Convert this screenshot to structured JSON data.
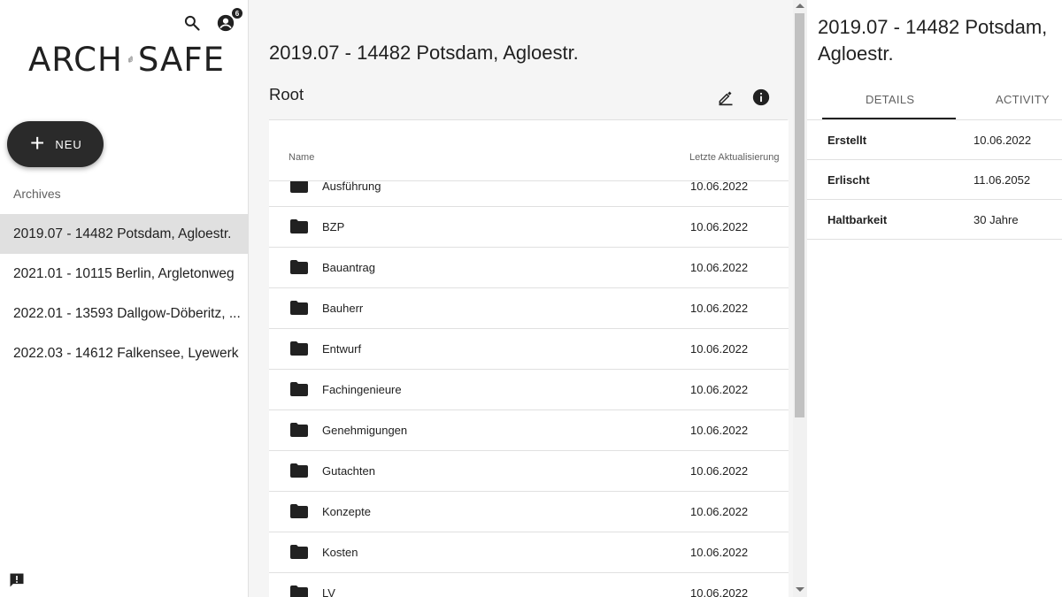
{
  "sidebar": {
    "logo": {
      "left_text": "ARCH",
      "right_text": "SAFE"
    },
    "notification_count": "6",
    "new_button_label": "NEU",
    "archives_label": "Archives",
    "archives": [
      {
        "label": "2019.07 - 14482 Potsdam, Agloestr.",
        "active": true
      },
      {
        "label": "2021.01 - 10115 Berlin, Argletonweg",
        "active": false
      },
      {
        "label": "2022.01 - 13593 Dallgow-Döberitz, ...",
        "active": false
      },
      {
        "label": "2022.03 - 14612 Falkensee, Lyewerk",
        "active": false
      }
    ]
  },
  "main": {
    "title": "2019.07 - 14482 Potsdam, Agloestr.",
    "path_label": "Root",
    "table": {
      "col_name": "Name",
      "col_date": "Letzte Aktualisierung",
      "rows": [
        {
          "name": "Ausführung",
          "date": "10.06.2022"
        },
        {
          "name": "BZP",
          "date": "10.06.2022"
        },
        {
          "name": "Bauantrag",
          "date": "10.06.2022"
        },
        {
          "name": "Bauherr",
          "date": "10.06.2022"
        },
        {
          "name": "Entwurf",
          "date": "10.06.2022"
        },
        {
          "name": "Fachingenieure",
          "date": "10.06.2022"
        },
        {
          "name": "Genehmigungen",
          "date": "10.06.2022"
        },
        {
          "name": "Gutachten",
          "date": "10.06.2022"
        },
        {
          "name": "Konzepte",
          "date": "10.06.2022"
        },
        {
          "name": "Kosten",
          "date": "10.06.2022"
        },
        {
          "name": "LV",
          "date": "10.06.2022"
        }
      ]
    }
  },
  "details": {
    "title": "2019.07 - 14482 Potsdam, Agloestr.",
    "tabs": {
      "details": "DETAILS",
      "activity": "ACTIVITY"
    },
    "rows": [
      {
        "key": "Erstellt",
        "value": "10.06.2022"
      },
      {
        "key": "Erlischt",
        "value": "11.06.2052"
      },
      {
        "key": "Haltbarkeit",
        "value": "30 Jahre"
      }
    ]
  },
  "colors": {
    "primary": "#212121",
    "active_bg": "#e0e0e0",
    "main_bg": "#f5f5f5"
  }
}
